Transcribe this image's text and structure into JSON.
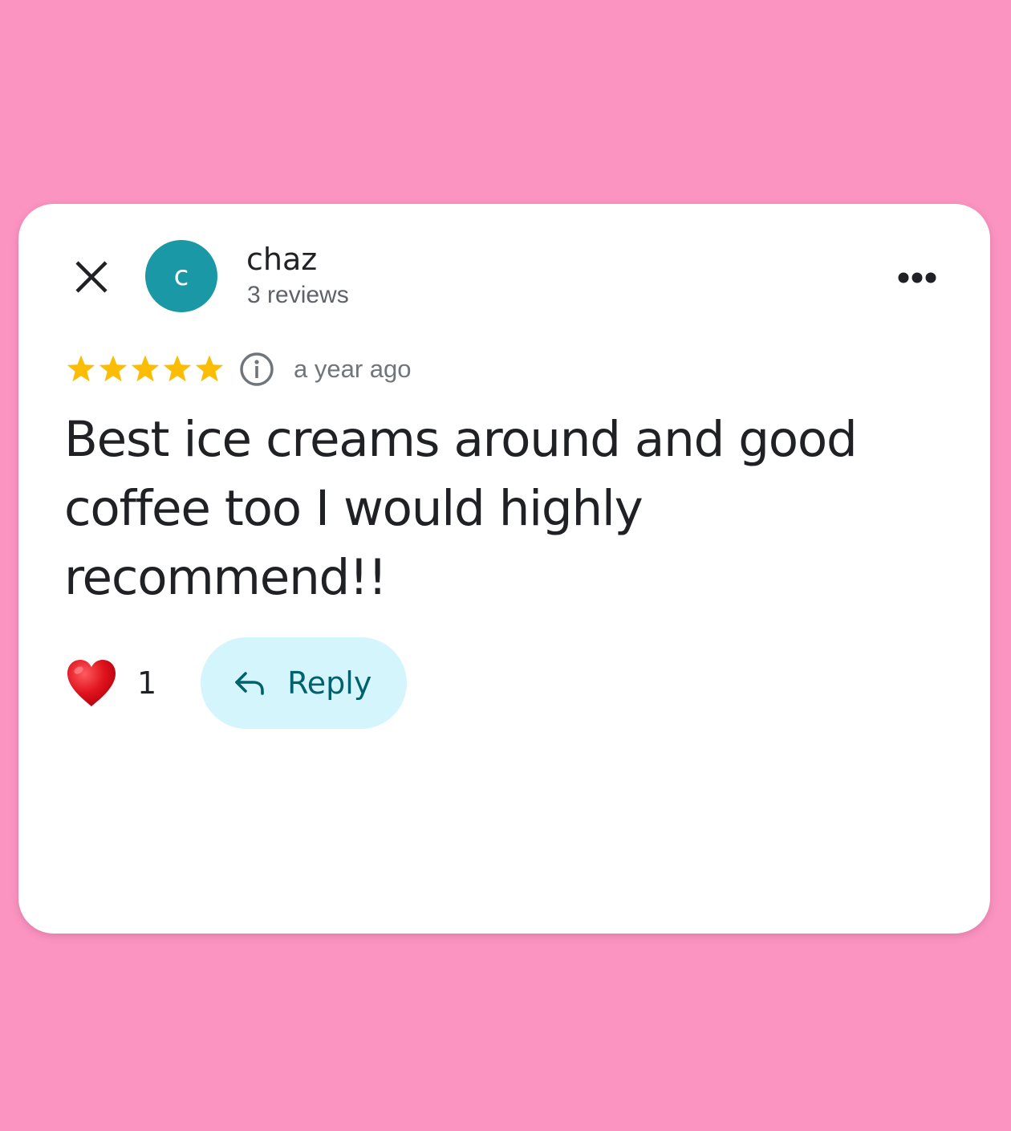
{
  "colors": {
    "page_background": "#fb94c1",
    "avatar_background": "#1a98a6",
    "star_fill": "#fbbc04",
    "reply_button_background": "#d3f5fb",
    "reply_button_text": "#00626c",
    "heart": "#e0141e"
  },
  "header": {
    "close_icon": "close-icon",
    "avatar_initial": "c",
    "author_name": "chaz",
    "author_reviews": "3 reviews",
    "more_icon": "more-horizontal-icon"
  },
  "rating": {
    "stars": 5,
    "max_stars": 5,
    "info_icon": "info-icon",
    "date": "a year ago"
  },
  "review": {
    "text": "Best ice creams around and good coffee too I would highly recommend!!"
  },
  "actions": {
    "heart_icon": "heart-icon",
    "like_count": "1",
    "reply_icon": "reply-arrow-icon",
    "reply_label": "Reply"
  }
}
